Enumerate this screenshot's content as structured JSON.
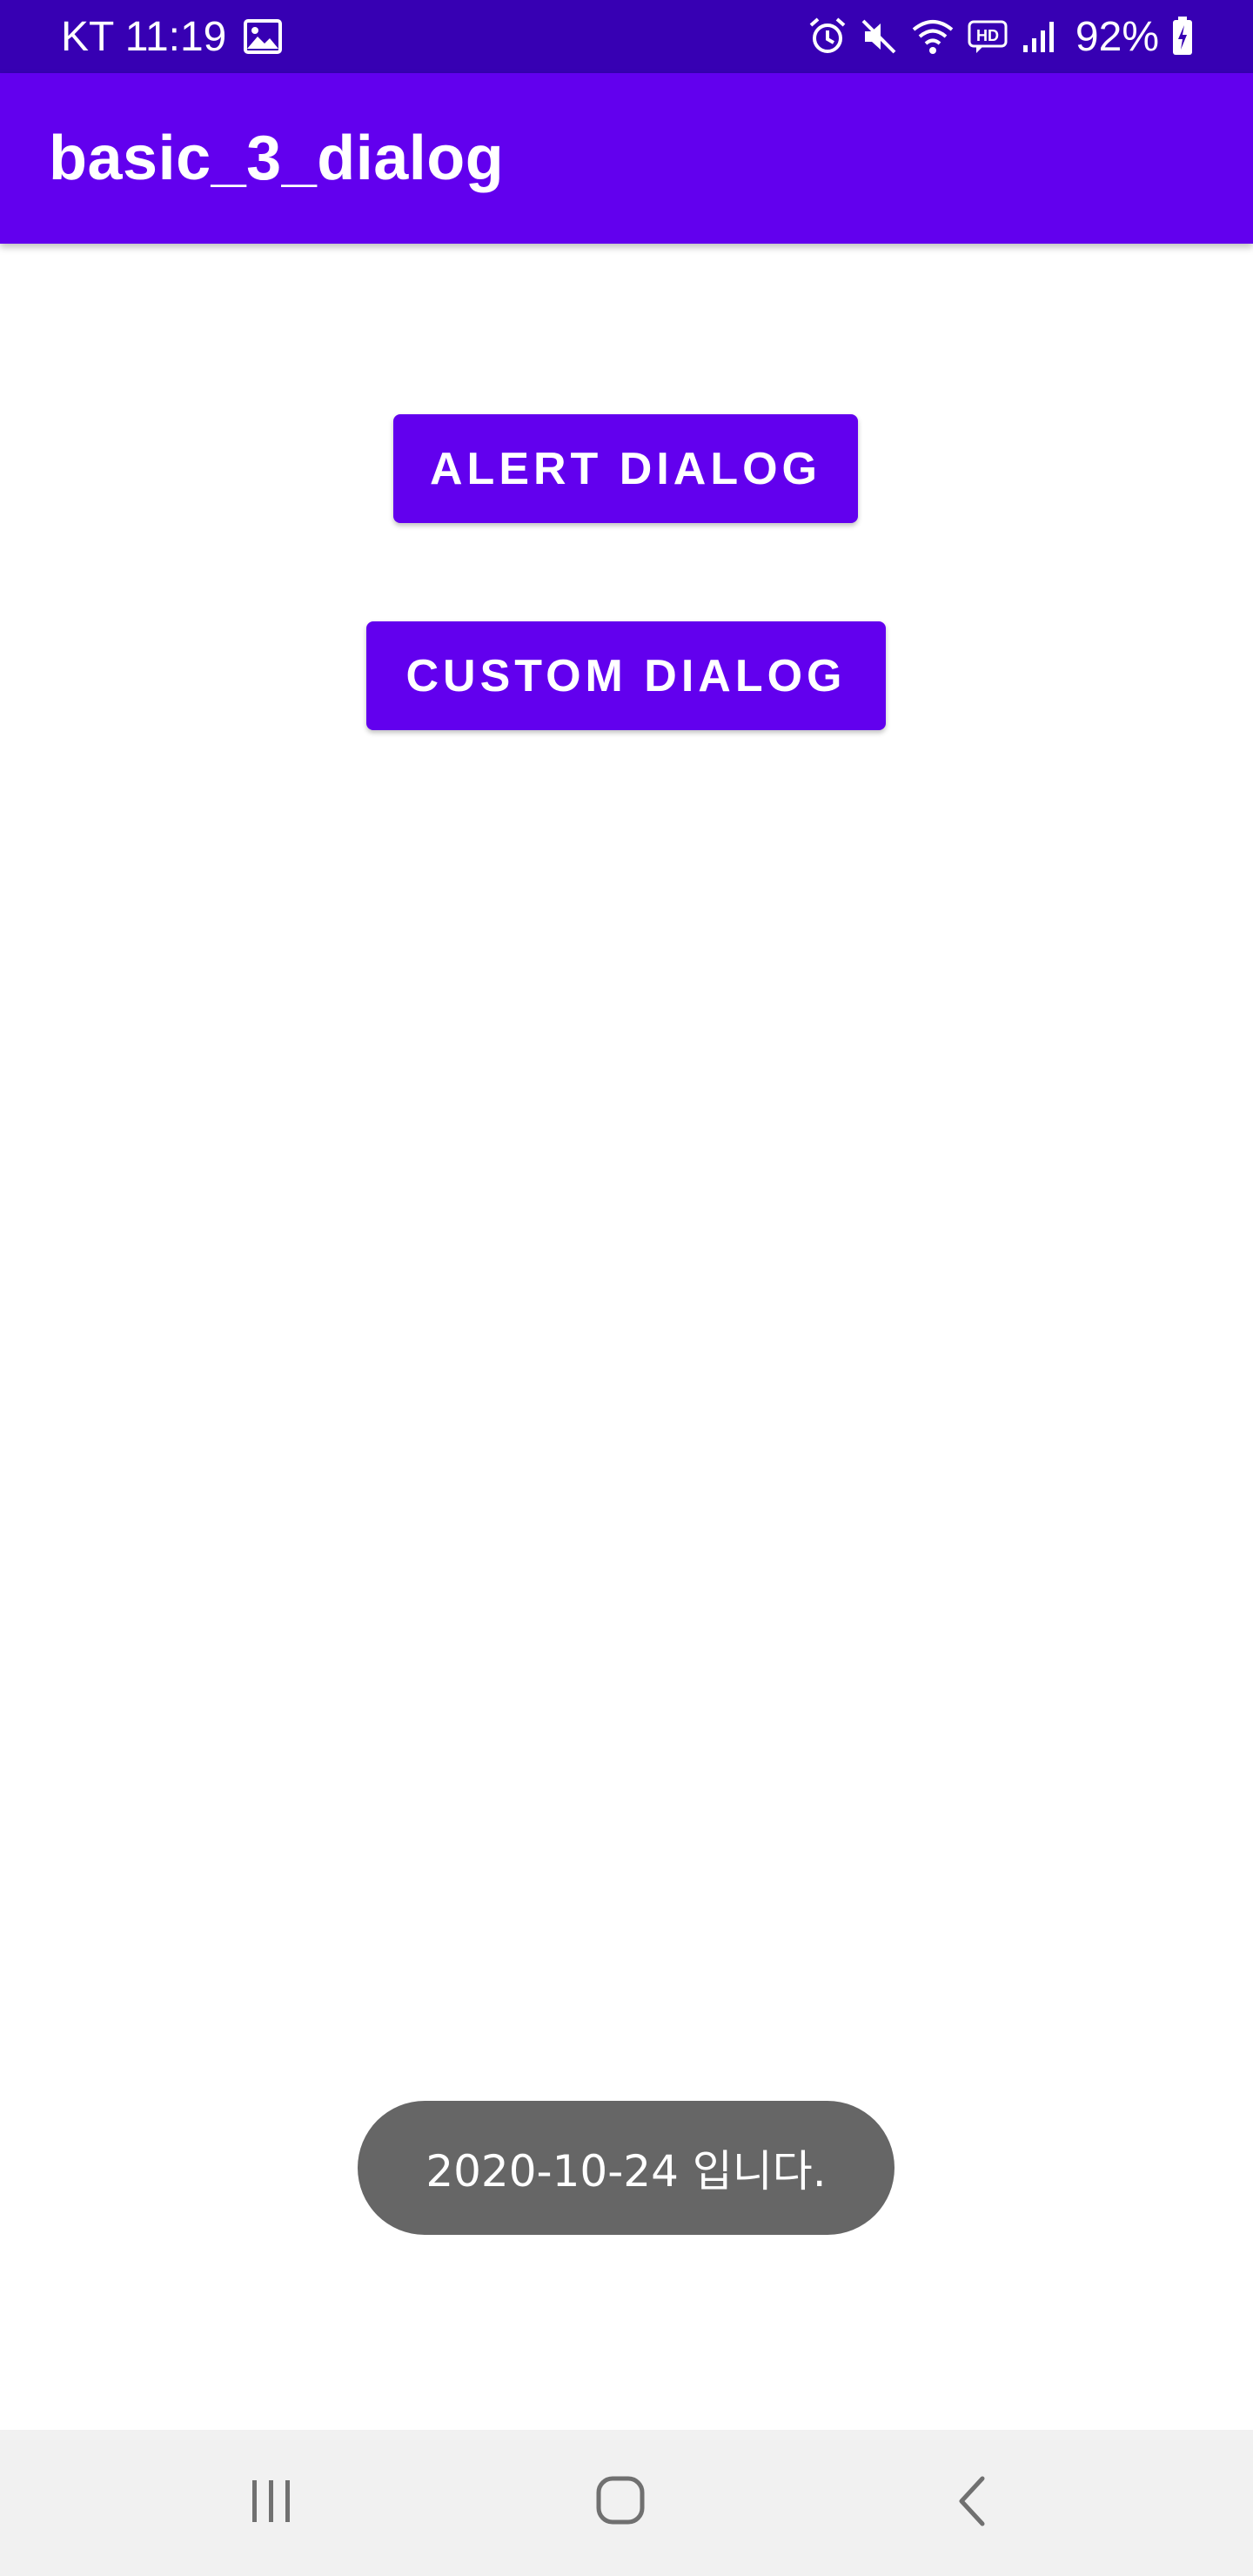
{
  "status_bar": {
    "carrier_time": "KT 11:19",
    "battery_percent": "92%",
    "icons": [
      "gallery-icon",
      "alarm-icon",
      "mute-icon",
      "wifi-icon",
      "hd-voice-icon",
      "signal-icon",
      "battery-charging-icon"
    ]
  },
  "app_bar": {
    "title": "basic_3_dialog"
  },
  "main": {
    "alert_button_label": "ALERT DIALOG",
    "custom_button_label": "CUSTOM DIALOG"
  },
  "toast": {
    "message": "2020-10-24 입니다."
  },
  "nav_bar": {
    "icons": [
      "recents-icon",
      "home-icon",
      "back-icon"
    ]
  },
  "colors": {
    "status_bar": "#3700B3",
    "primary": "#6200EE",
    "toast_bg": "#666666",
    "nav_bg": "#F1F1F1"
  }
}
